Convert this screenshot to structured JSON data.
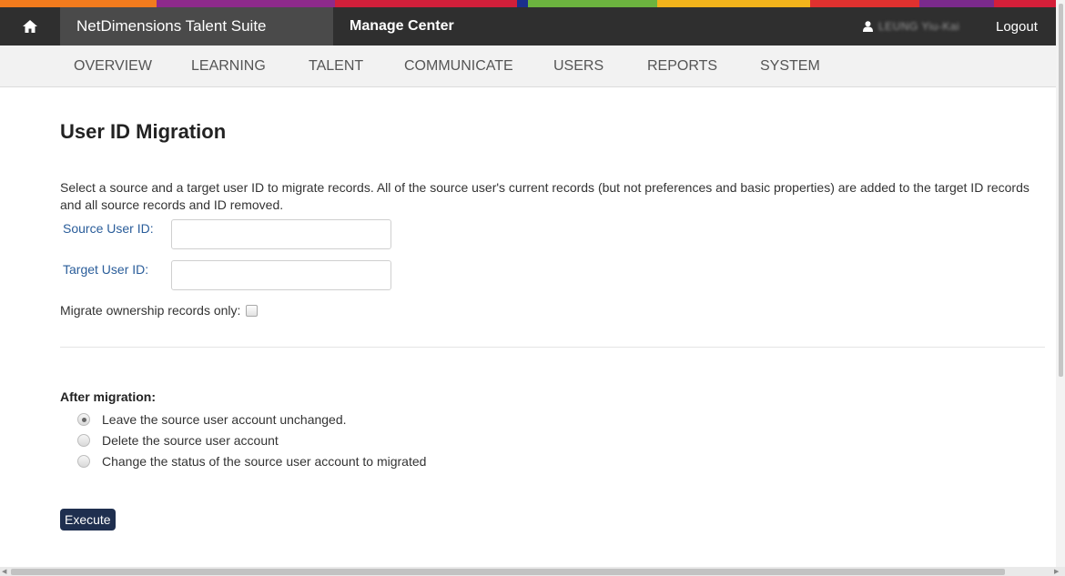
{
  "colors": {
    "stripe": [
      "#f27b1d",
      "#8e2a8b",
      "#d11f3a",
      "#1b2f8c",
      "#6cb33f",
      "#f2b31b",
      "#e0312f",
      "#7b2a8c",
      "#d51f39"
    ],
    "topbar": "#2f2f2f",
    "brand_bg": "#4a4a4a",
    "label_blue": "#2a5d9a",
    "execute_bg": "#1f2f4f"
  },
  "header": {
    "home_icon": "home-icon",
    "brand": "NetDimensions Talent Suite",
    "section": "Manage Center",
    "user_icon": "user-icon",
    "user_name": "LEUNG Yiu-Kai",
    "logout": "Logout"
  },
  "nav": {
    "items": [
      "OVERVIEW",
      "LEARNING",
      "TALENT",
      "COMMUNICATE",
      "USERS",
      "REPORTS",
      "SYSTEM"
    ]
  },
  "main": {
    "title": "User ID Migration",
    "description": "Select a source and a target user ID to migrate records. All of the source user's current records (but not preferences and basic properties) are added to the target ID records and all source records and ID removed.",
    "source_label": "Source User ID:",
    "source_value": "",
    "target_label": "Target User ID:",
    "target_value": "",
    "ownership_label": "Migrate ownership records only:",
    "ownership_checked": false,
    "after_label": "After migration:",
    "options": [
      {
        "label": "Leave the source user account unchanged.",
        "checked": true
      },
      {
        "label": "Delete the source user account",
        "checked": false
      },
      {
        "label": "Change the status of the source user account to migrated",
        "checked": false
      }
    ],
    "execute": "Execute"
  }
}
